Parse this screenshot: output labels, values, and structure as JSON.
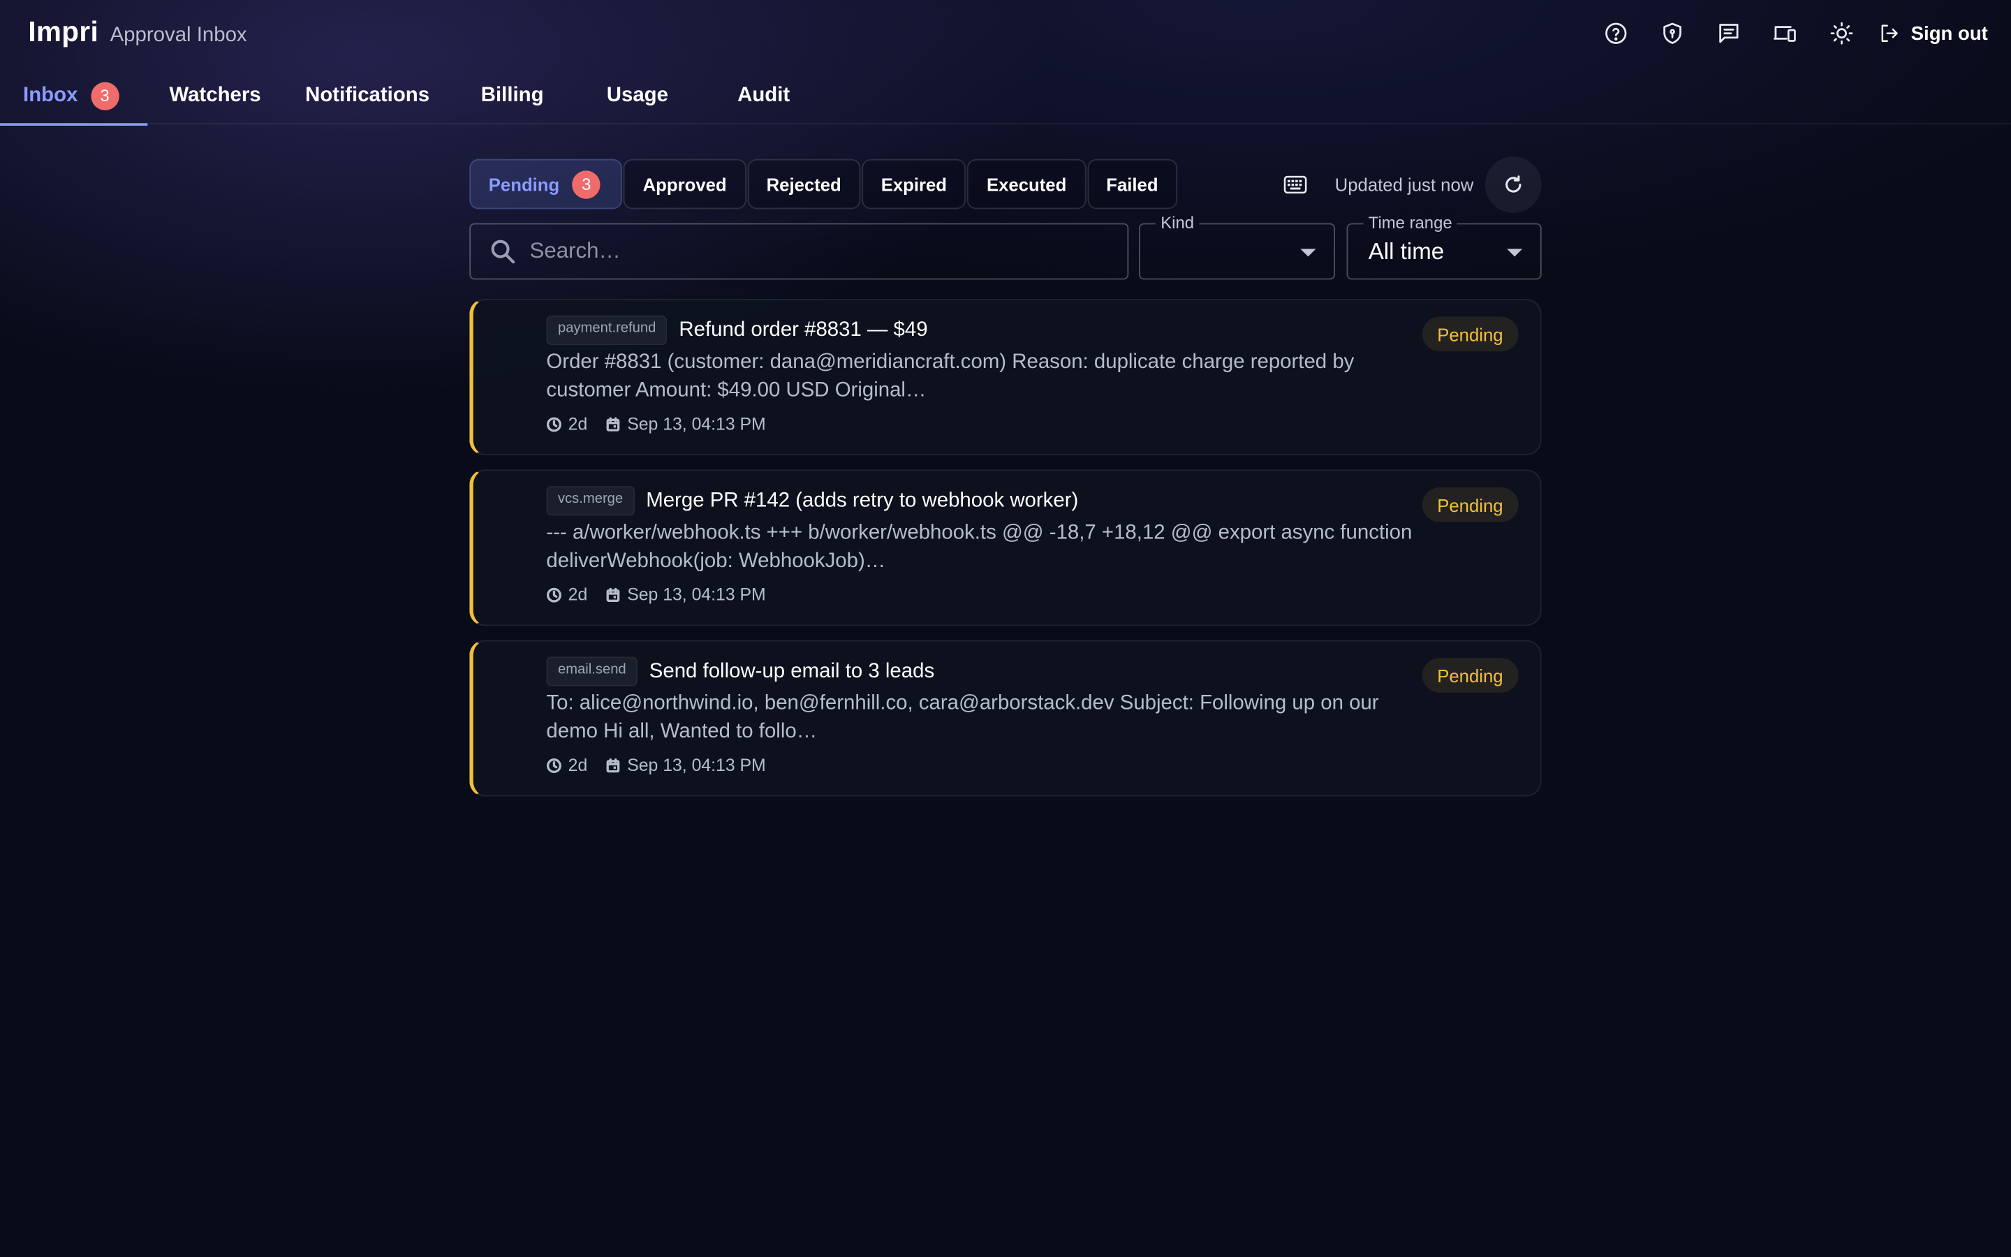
{
  "app": {
    "name": "Impri",
    "page_title": "Approval Inbox"
  },
  "header": {
    "icons": [
      "help-icon",
      "shield-icon",
      "chat-icon",
      "devices-icon",
      "theme-icon"
    ],
    "signout_label": "Sign out"
  },
  "nav": {
    "tabs": [
      {
        "label": "Inbox",
        "badge": "3",
        "active": true
      },
      {
        "label": "Watchers"
      },
      {
        "label": "Notifications"
      },
      {
        "label": "Billing"
      },
      {
        "label": "Usage"
      },
      {
        "label": "Audit"
      }
    ]
  },
  "filters": {
    "status_tabs": [
      {
        "label": "Pending",
        "badge": "3",
        "active": true
      },
      {
        "label": "Approved"
      },
      {
        "label": "Rejected"
      },
      {
        "label": "Expired"
      },
      {
        "label": "Executed"
      },
      {
        "label": "Failed"
      }
    ],
    "updated_text": "Updated just now"
  },
  "search": {
    "placeholder": "Search…",
    "value": ""
  },
  "kind_select": {
    "label": "Kind",
    "value": ""
  },
  "time_select": {
    "label": "Time range",
    "value": "All time"
  },
  "requests": [
    {
      "kind": "payment.refund",
      "title": "Refund order #8831 — $49",
      "body": "Order #8831 (customer: dana@meridiancraft.com) Reason: duplicate charge reported by customer Amount: $49.00 USD Original…",
      "age": "2d",
      "date": "Sep 13, 04:13 PM",
      "status": "Pending"
    },
    {
      "kind": "vcs.merge",
      "title": "Merge PR #142 (adds retry to webhook worker)",
      "body": "--- a/worker/webhook.ts +++ b/worker/webhook.ts @@ -18,7 +18,12 @@ export async function deliverWebhook(job: WebhookJob)…",
      "age": "2d",
      "date": "Sep 13, 04:13 PM",
      "status": "Pending"
    },
    {
      "kind": "email.send",
      "title": "Send follow-up email to 3 leads",
      "body": "To: alice@northwind.io, ben@fernhill.co, cara@arborstack.dev Subject: Following up on our demo Hi all, Wanted to follo…",
      "age": "2d",
      "date": "Sep 13, 04:13 PM",
      "status": "Pending"
    }
  ],
  "colors": {
    "accent": "#8a9cff",
    "pending": "#f2bf3a",
    "badge": "#f06b6b",
    "background": "#080b18"
  }
}
